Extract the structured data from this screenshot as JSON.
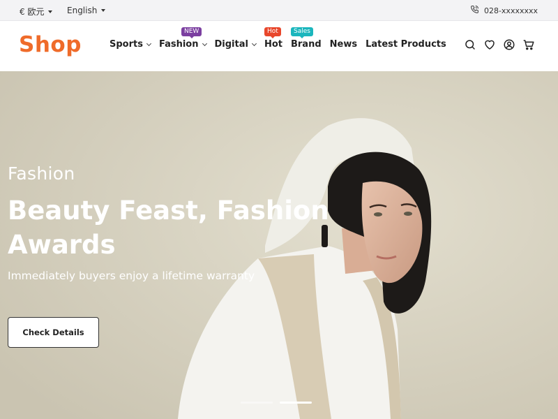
{
  "topbar": {
    "currency": "€ 欧元",
    "language": "English",
    "phone": "028-xxxxxxxx"
  },
  "header": {
    "logo": "Shop",
    "logo_color": "#ef6b2a",
    "nav": [
      {
        "label": "Sports",
        "dropdown": true
      },
      {
        "label": "Fashion",
        "dropdown": true,
        "badge": "NEW",
        "badge_color": "#7b3fa0"
      },
      {
        "label": "Digital",
        "dropdown": true
      },
      {
        "label": "Hot",
        "dropdown": false,
        "badge": "Hot",
        "badge_color": "#e8472c"
      },
      {
        "label": "Brand",
        "dropdown": false,
        "badge": "Sales",
        "badge_color": "#1bb6bd"
      },
      {
        "label": "News",
        "dropdown": false
      },
      {
        "label": "Latest Products",
        "dropdown": false
      }
    ],
    "icons": [
      "search-icon",
      "heart-icon",
      "user-icon",
      "cart-icon"
    ]
  },
  "hero": {
    "category": "Fashion",
    "title": "Beauty Feast, Fashion Awards",
    "subtitle": "Immediately buyers enjoy a lifetime warranty",
    "button": "Check Details",
    "slides": 2,
    "active_slide": 2
  }
}
